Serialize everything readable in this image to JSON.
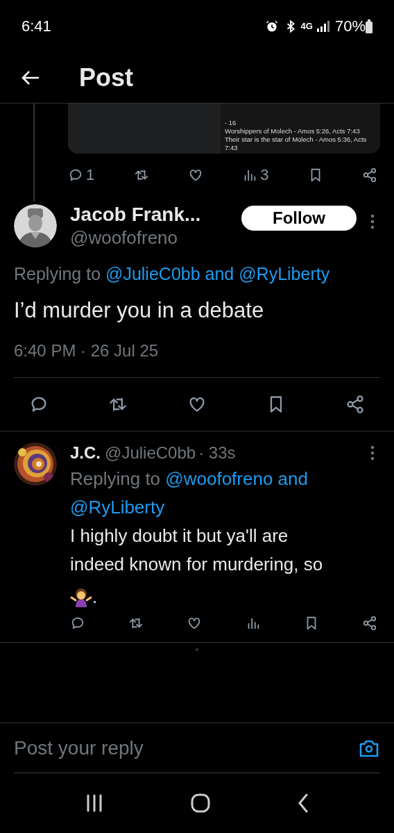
{
  "status_bar": {
    "time": "6:41",
    "network": "4G",
    "battery": "70%"
  },
  "header": {
    "title": "Post"
  },
  "quoted_post": {
    "image_text": [
      "- 16",
      "Worshippers of Molech - Amos 5:26, Acts 7:43",
      "Their star is the star of Molech - Amos 5:36, Acts 7:43"
    ],
    "actions": [
      {
        "kind": "reply",
        "count": "1"
      },
      {
        "kind": "repost"
      },
      {
        "kind": "like"
      },
      {
        "kind": "views",
        "count": "3"
      },
      {
        "kind": "bookmark"
      },
      {
        "kind": "share"
      }
    ]
  },
  "main_post": {
    "name": "Jacob Frank...",
    "handle": "@woofofreno",
    "follow": "Follow",
    "replying_label": "Replying to",
    "replying_to": "@JulieC0bb and @RyLiberty",
    "text": "I’d murder you in a debate",
    "timestamp": "6:40 PM · 26 Jul 25",
    "actions": [
      {
        "kind": "reply"
      },
      {
        "kind": "repost"
      },
      {
        "kind": "like"
      },
      {
        "kind": "bookmark"
      },
      {
        "kind": "share"
      }
    ]
  },
  "reply": {
    "name": "J.C.",
    "handle": "@JulieC0bb",
    "age": "· 33s",
    "replying_label": "Replying to",
    "replying_to": "@woofofreno and @RyLiberty",
    "text": "I highly doubt it but ya'll are indeed known for murdering, so",
    "text_end": ".",
    "actions": [
      {
        "kind": "reply"
      },
      {
        "kind": "repost"
      },
      {
        "kind": "like"
      },
      {
        "kind": "views"
      },
      {
        "kind": "bookmark"
      },
      {
        "kind": "share"
      }
    ]
  },
  "composer": {
    "placeholder": "Post your reply"
  }
}
